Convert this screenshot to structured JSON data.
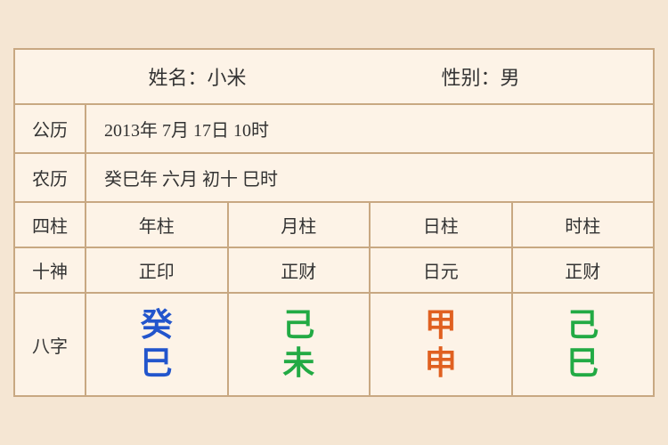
{
  "header": {
    "name_label": "姓名：小米",
    "gender_label": "性别：男"
  },
  "solar": {
    "label": "公历",
    "value": "2013年 7月 17日 10时"
  },
  "lunar": {
    "label": "农历",
    "value": "癸巳年 六月 初十 巳时"
  },
  "sizhu": {
    "label": "四柱",
    "columns": [
      "年柱",
      "月柱",
      "日柱",
      "时柱"
    ]
  },
  "shishen": {
    "label": "十神",
    "columns": [
      "正印",
      "正财",
      "日元",
      "正财"
    ]
  },
  "bazhi": {
    "label": "八字",
    "columns": [
      {
        "top": "癸",
        "bottom": "巳",
        "top_color": "blue",
        "bottom_color": "blue"
      },
      {
        "top": "己",
        "bottom": "未",
        "top_color": "green",
        "bottom_color": "green"
      },
      {
        "top": "甲",
        "bottom": "申",
        "top_color": "orange",
        "bottom_color": "orange"
      },
      {
        "top": "己",
        "bottom": "巳",
        "top_color": "green2",
        "bottom_color": "green2"
      }
    ]
  }
}
